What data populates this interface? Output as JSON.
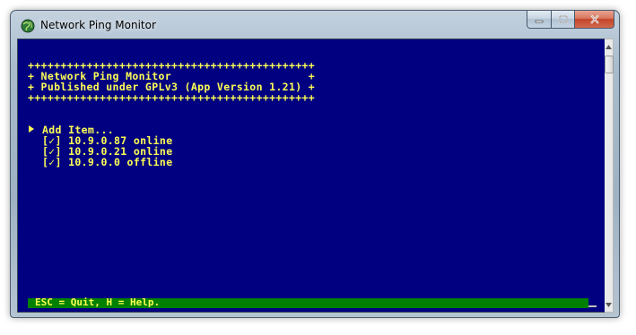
{
  "window": {
    "title": "Network Ping Monitor",
    "icon": "globe-icon"
  },
  "controls": {
    "minimize": "minimize-icon",
    "maximize": "maximize-icon",
    "close": "close-icon"
  },
  "console": {
    "border_line": "++++++++++++++++++++++++++++++++++++++++++++",
    "header_line1": "+ Network Ping Monitor                     +",
    "header_line2": "+ Published under GPLv3 (App Version 1.21) +",
    "menu": [
      {
        "text": "Add Item...",
        "selected": true
      },
      {
        "text": "[✓] 10.9.0.87 online",
        "selected": false
      },
      {
        "text": "[✓] 10.9.0.21 online",
        "selected": false
      },
      {
        "text": "[✓] 10.9.0.0 offline",
        "selected": false
      }
    ],
    "status_bar": "ESC = Quit, H = Help."
  },
  "colors": {
    "console_bg": "#000080",
    "console_text": "#ffff55",
    "status_bg": "#008000"
  }
}
